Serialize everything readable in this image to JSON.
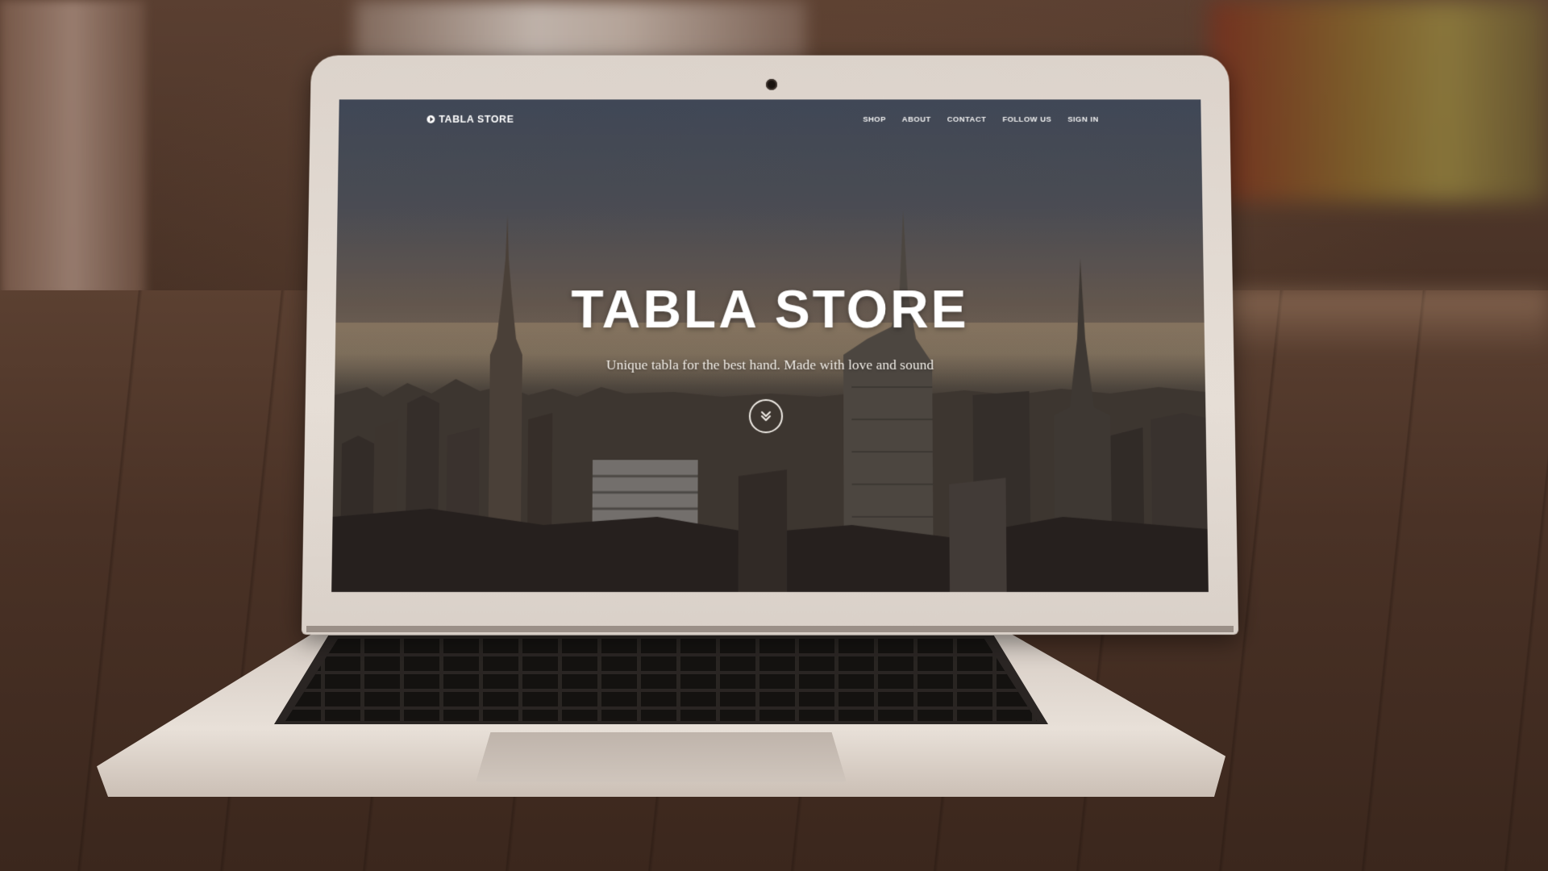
{
  "site": {
    "brand": "TABLA STORE",
    "menu": [
      {
        "label": "SHOP"
      },
      {
        "label": "ABOUT"
      },
      {
        "label": "CONTACT"
      },
      {
        "label": "FOLLOW US"
      },
      {
        "label": "SIGN IN"
      }
    ],
    "hero": {
      "title": "TABLA STORE",
      "subtitle": "Unique tabla for the best hand. Made with love and sound",
      "scroll_icon": "double-chevron-down-icon"
    }
  },
  "colors": {
    "text": "#ffffff",
    "overlay": "#1f1d22",
    "sky_top": "#4d5768",
    "sky_glow": "#8a7a66",
    "laptop_silver": "#e6ded6",
    "floor": "#4a3226"
  }
}
